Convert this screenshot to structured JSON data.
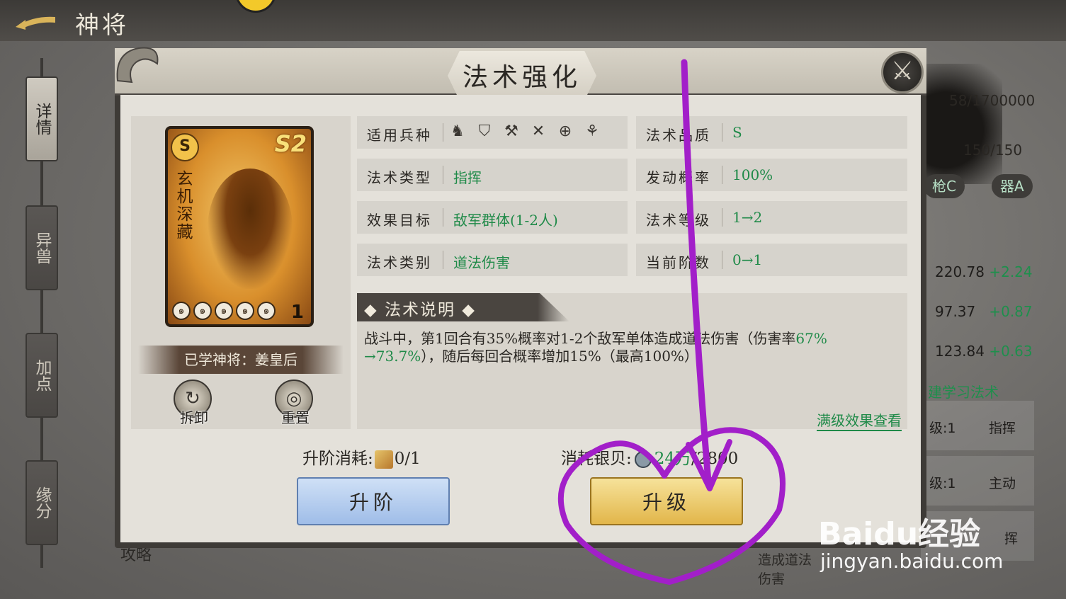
{
  "topbar": {
    "title": "神将"
  },
  "sidebar": {
    "tabs": [
      {
        "label": "详情",
        "active": true
      },
      {
        "label": "异兽",
        "active": false
      },
      {
        "label": "加点",
        "active": false
      },
      {
        "label": "缘分",
        "active": false
      }
    ]
  },
  "background_panel": {
    "exp": "58/1700000",
    "stamina": "150/150",
    "tag1": "枪C",
    "tag2": "器A",
    "stats": [
      {
        "value": "220.78",
        "delta": "+2.24"
      },
      {
        "value": "97.37",
        "delta": "+0.87"
      },
      {
        "value": "123.84",
        "delta": "+0.63"
      }
    ],
    "learn_link": "建学习法术",
    "rows": [
      {
        "left": "级:1",
        "right": "指挥"
      },
      {
        "left": "级:1",
        "right": "主动"
      },
      {
        "left": "",
        "right": "挥"
      }
    ],
    "bottom_text": "造成道法伤害",
    "bottom_left": "攻略"
  },
  "modal": {
    "title": "法术强化",
    "close_icon": "crossed-swords-icon",
    "card": {
      "rarity": "S",
      "grade": "S2",
      "name": "玄机深藏",
      "stars": 5,
      "level": "1"
    },
    "learned_by": "已学神将：姜皇后",
    "buttons": {
      "unload": "拆卸",
      "reset": "重置",
      "advance": "升阶",
      "upgrade": "升级"
    },
    "info": {
      "unit_label": "适用兵种",
      "unit_icons": [
        "cavalry-icon",
        "shield-icon",
        "crossbow-icon",
        "crossed-spears-icon",
        "target-icon",
        "fan-icon"
      ],
      "quality_label": "法术品质",
      "quality_value": "S",
      "type_label": "法术类型",
      "type_value": "指挥",
      "rate_label": "发动概率",
      "rate_value": "100%",
      "target_label": "效果目标",
      "target_value": "敌军群体(1-2人)",
      "level_label": "法术等级",
      "level_value": "1→2",
      "category_label": "法术类别",
      "category_value": "道法伤害",
      "stage_label": "当前阶数",
      "stage_value": "0→1"
    },
    "description": {
      "title": "法术说明",
      "text_a": "战斗中，第1回合有35%概率对1-2个敌军单体造成道法伤害（伤害率",
      "text_green1": "67%",
      "text_green2": "→73.7%",
      "text_b": "），随后每回合概率增加15%（最高100%）",
      "full_link": "满级效果查看"
    },
    "cost": {
      "advance_label": "升阶消耗:",
      "advance_value": "0/1",
      "silver_label": "消耗银贝:",
      "silver_current": "24万",
      "silver_total": "/2800"
    }
  },
  "annotation": {
    "color": "#a21fc9"
  },
  "watermark": {
    "brand": "Baidu经验",
    "url": "jingyan.baidu.com"
  }
}
